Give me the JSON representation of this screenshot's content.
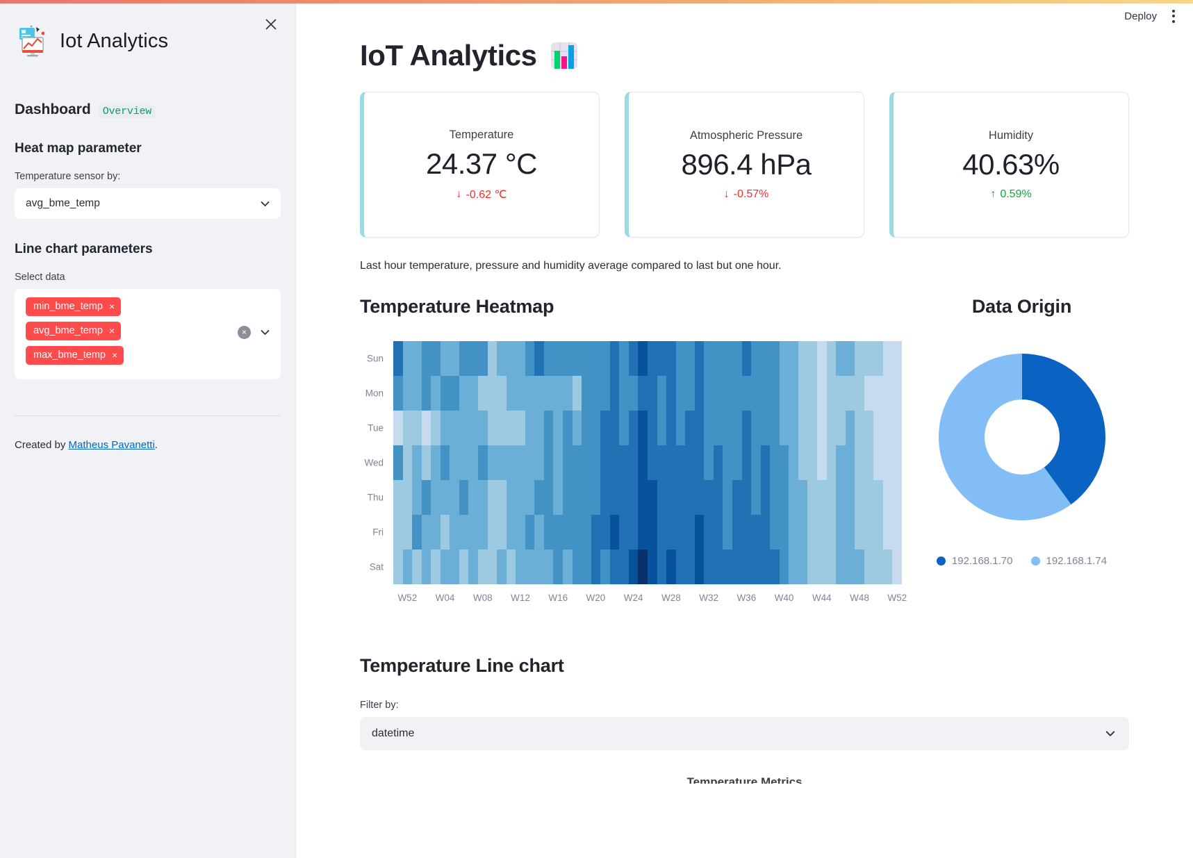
{
  "window": {
    "deploy_label": "Deploy",
    "menu_icon": "kebab-menu-icon",
    "close_icon": "close-icon"
  },
  "sidebar": {
    "brand": {
      "icon": "chart-monitor-icon",
      "title": "Iot Analytics"
    },
    "dashboard": {
      "title": "Dashboard",
      "badge": "Overview"
    },
    "heatmap_section": {
      "heading": "Heat map parameter",
      "field_label": "Temperature sensor by:",
      "selected": "avg_bme_temp",
      "chevron_icon": "chevron-down-icon"
    },
    "linechart_section": {
      "heading": "Line chart parameters",
      "field_label": "Select data",
      "tags": [
        "min_bme_temp",
        "avg_bme_temp",
        "max_bme_temp"
      ],
      "tag_remove_glyph": "×",
      "clear_all_glyph": "×",
      "clear_all_icon": "clear-all-icon",
      "chevron_icon": "chevron-down-icon"
    },
    "footer": {
      "prefix": "Created by ",
      "link": "Matheus Pavanetti",
      "suffix": "."
    }
  },
  "main": {
    "page_title": "IoT Analytics",
    "title_emoji": "bar-chart-emoji",
    "cards": [
      {
        "label": "Temperature",
        "value": "24.37 °C",
        "delta": "-0.62 ℃",
        "direction": "down",
        "arrow": "↓"
      },
      {
        "label": "Atmospheric Pressure",
        "value": "896.4 hPa",
        "delta": "-0.57%",
        "direction": "down",
        "arrow": "↓"
      },
      {
        "label": "Humidity",
        "value": "40.63%",
        "delta": "0.59%",
        "direction": "up",
        "arrow": "↑"
      }
    ],
    "caption": "Last hour temperature, pressure and humidity average compared to last but one hour.",
    "heatmap_title": "Temperature Heatmap",
    "donut_title": "Data Origin",
    "line_section": {
      "title": "Temperature Line chart",
      "filter_label": "Filter by:",
      "filter_value": "datetime",
      "chevron_icon": "chevron-down-icon"
    },
    "bottom_partial_title": "Temperature Metrics"
  },
  "colors": {
    "accent_card_bar": "#9ddbe4",
    "tag_red": "#ff4b4b",
    "delta_down": "#ff2b2b",
    "delta_up": "#09ab3b",
    "link": "#0068c9",
    "donut_dark": "#0a62c2",
    "donut_light": "#83bdf5",
    "sidebar_bg": "#f0f2f6"
  },
  "chart_data": [
    {
      "type": "heatmap",
      "title": "Temperature Heatmap",
      "xlabel": "",
      "ylabel": "",
      "y_categories": [
        "Sun",
        "Mon",
        "Tue",
        "Wed",
        "Thu",
        "Fri",
        "Sat"
      ],
      "x_tick_labels": [
        "W52",
        "W04",
        "W08",
        "W12",
        "W16",
        "W20",
        "W24",
        "W28",
        "W32",
        "W36",
        "W40",
        "W44",
        "W48",
        "W52"
      ],
      "x_tick_positions": [
        1,
        5,
        9,
        13,
        17,
        21,
        25,
        29,
        33,
        37,
        41,
        45,
        49,
        53
      ],
      "columns": 54,
      "colorscale": [
        "#deebf7",
        "#c6dbef",
        "#9ecae1",
        "#6baed6",
        "#4292c6",
        "#2171b5",
        "#08519c",
        "#08306b"
      ],
      "legend": "none",
      "grid": false,
      "values": [
        [
          0.72,
          0.46,
          0.44,
          0.5,
          0.52,
          0.48,
          0.44,
          0.58,
          0.52,
          0.5,
          0.3,
          0.4,
          0.44,
          0.46,
          0.6,
          0.7,
          0.5,
          0.54,
          0.58,
          0.52,
          0.56,
          0.62,
          0.6,
          0.7,
          0.58,
          0.72,
          0.88,
          0.78,
          0.66,
          0.72,
          0.6,
          0.64,
          0.7,
          0.58,
          0.62,
          0.54,
          0.6,
          0.66,
          0.56,
          0.62,
          0.58,
          0.48,
          0.4,
          0.3,
          0.24,
          0.18,
          0.26,
          0.36,
          0.42,
          0.3,
          0.26,
          0.22,
          0.18,
          0.14
        ],
        [
          0.52,
          0.44,
          0.38,
          0.58,
          0.46,
          0.54,
          0.56,
          0.4,
          0.44,
          0.28,
          0.24,
          0.34,
          0.42,
          0.38,
          0.48,
          0.4,
          0.46,
          0.36,
          0.4,
          0.34,
          0.56,
          0.5,
          0.62,
          0.68,
          0.58,
          0.64,
          0.78,
          0.7,
          0.6,
          0.66,
          0.58,
          0.62,
          0.68,
          0.56,
          0.6,
          0.52,
          0.58,
          0.62,
          0.54,
          0.58,
          0.52,
          0.44,
          0.36,
          0.28,
          0.22,
          0.16,
          0.22,
          0.3,
          0.34,
          0.26,
          0.2,
          0.16,
          0.12,
          0.1
        ],
        [
          0.2,
          0.26,
          0.22,
          0.18,
          0.3,
          0.4,
          0.46,
          0.38,
          0.42,
          0.36,
          0.32,
          0.26,
          0.22,
          0.34,
          0.44,
          0.38,
          0.5,
          0.46,
          0.52,
          0.44,
          0.54,
          0.58,
          0.66,
          0.72,
          0.62,
          0.7,
          0.82,
          0.74,
          0.64,
          0.7,
          0.62,
          0.66,
          0.72,
          0.6,
          0.64,
          0.56,
          0.6,
          0.66,
          0.58,
          0.62,
          0.56,
          0.46,
          0.38,
          0.3,
          0.24,
          0.18,
          0.26,
          0.34,
          0.4,
          0.28,
          0.24,
          0.18,
          0.14,
          0.12
        ],
        [
          0.58,
          0.34,
          0.42,
          0.28,
          0.36,
          0.52,
          0.48,
          0.44,
          0.4,
          0.5,
          0.46,
          0.38,
          0.42,
          0.48,
          0.4,
          0.44,
          0.52,
          0.48,
          0.56,
          0.5,
          0.58,
          0.62,
          0.7,
          0.76,
          0.66,
          0.74,
          0.86,
          0.78,
          0.68,
          0.74,
          0.66,
          0.7,
          0.76,
          0.64,
          0.68,
          0.6,
          0.64,
          0.7,
          0.62,
          0.66,
          0.6,
          0.5,
          0.42,
          0.34,
          0.26,
          0.2,
          0.28,
          0.36,
          0.42,
          0.3,
          0.26,
          0.2,
          0.16,
          0.12
        ],
        [
          0.24,
          0.3,
          0.44,
          0.52,
          0.46,
          0.38,
          0.42,
          0.5,
          0.44,
          0.4,
          0.34,
          0.3,
          0.38,
          0.46,
          0.42,
          0.5,
          0.54,
          0.48,
          0.58,
          0.52,
          0.6,
          0.64,
          0.72,
          0.78,
          0.68,
          0.76,
          0.88,
          0.8,
          0.7,
          0.76,
          0.68,
          0.72,
          0.78,
          0.66,
          0.7,
          0.62,
          0.66,
          0.72,
          0.64,
          0.68,
          0.62,
          0.52,
          0.44,
          0.36,
          0.28,
          0.22,
          0.3,
          0.38,
          0.44,
          0.32,
          0.28,
          0.22,
          0.18,
          0.14
        ],
        [
          0.28,
          0.34,
          0.56,
          0.38,
          0.44,
          0.32,
          0.4,
          0.48,
          0.36,
          0.42,
          0.3,
          0.34,
          0.46,
          0.4,
          0.52,
          0.44,
          0.56,
          0.5,
          0.6,
          0.54,
          0.62,
          0.66,
          0.74,
          0.8,
          0.7,
          0.78,
          0.92,
          0.84,
          0.72,
          0.78,
          0.7,
          0.74,
          0.8,
          0.68,
          0.72,
          0.64,
          0.68,
          0.74,
          0.66,
          0.7,
          0.64,
          0.54,
          0.46,
          0.38,
          0.3,
          0.24,
          0.32,
          0.4,
          0.46,
          0.34,
          0.3,
          0.24,
          0.2,
          0.16
        ],
        [
          0.3,
          0.38,
          0.34,
          0.42,
          0.28,
          0.36,
          0.44,
          0.32,
          0.4,
          0.26,
          0.32,
          0.38,
          0.3,
          0.44,
          0.36,
          0.48,
          0.42,
          0.54,
          0.46,
          0.58,
          0.52,
          0.7,
          0.64,
          0.76,
          0.68,
          0.84,
          0.96,
          0.88,
          0.74,
          0.8,
          0.72,
          0.76,
          0.82,
          0.7,
          0.74,
          0.66,
          0.7,
          0.76,
          0.68,
          0.72,
          0.66,
          0.56,
          0.48,
          0.4,
          0.32,
          0.26,
          0.34,
          0.42,
          0.48,
          0.36,
          0.32,
          0.26,
          0.22,
          0.18
        ]
      ]
    },
    {
      "type": "pie",
      "subtype": "donut",
      "title": "Data Origin",
      "labels": [
        "192.168.1.70",
        "192.168.1.74"
      ],
      "values": [
        40,
        60
      ],
      "colors": [
        "#0a62c2",
        "#83bdf5"
      ],
      "legend": "bottom",
      "hole": 0.45
    }
  ]
}
